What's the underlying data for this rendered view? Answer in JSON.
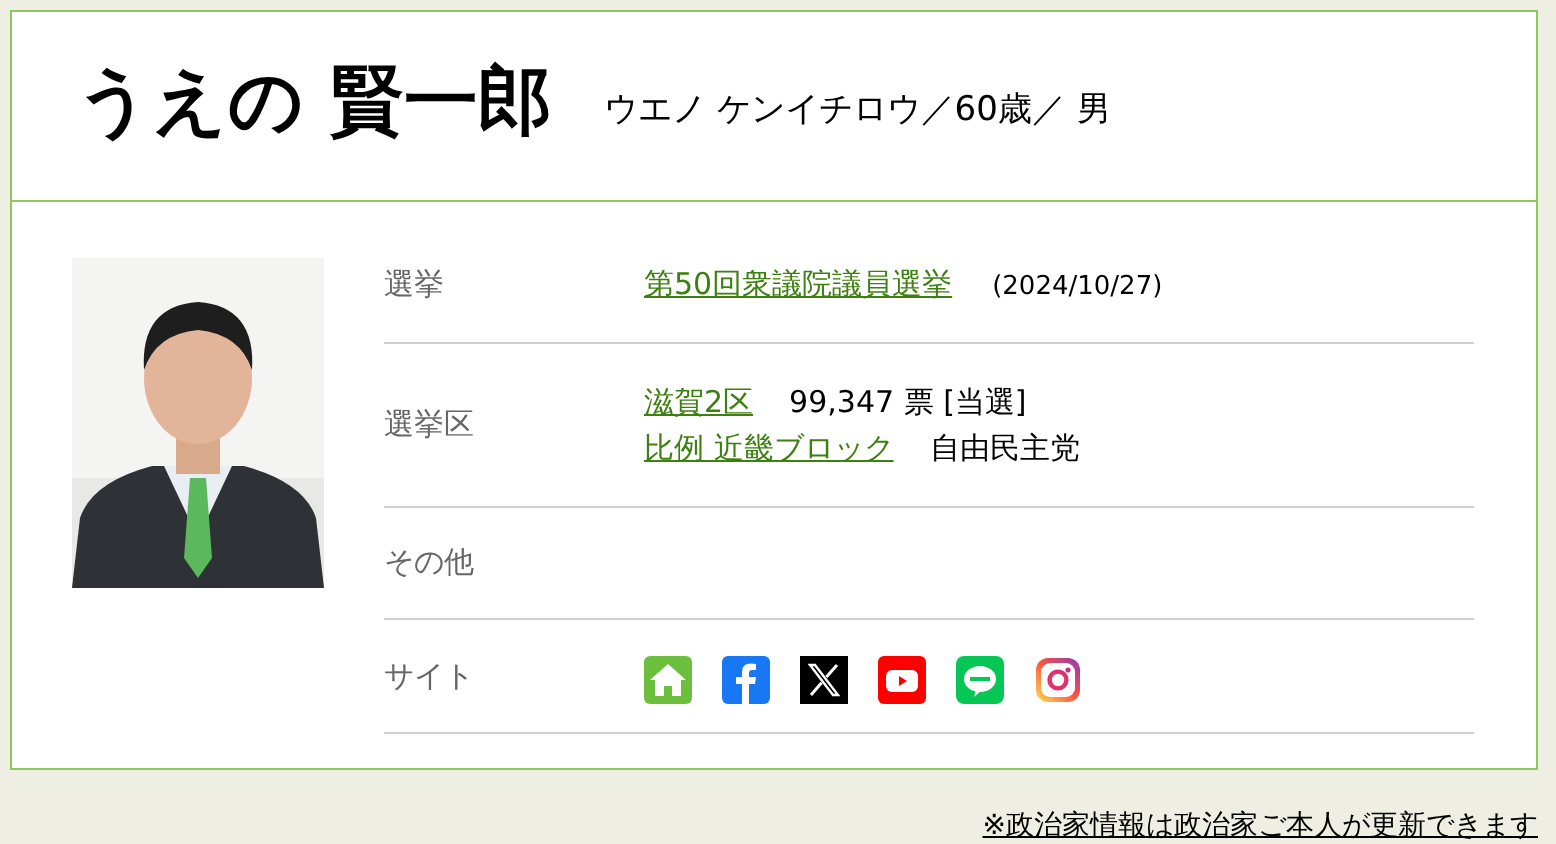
{
  "profile": {
    "name": "うえの 賢一郎",
    "reading": "ウエノ ケンイチロウ／60歳／ 男"
  },
  "rows": [
    {
      "kind": "text",
      "label": "選挙",
      "lines": [
        {
          "link": "第50回衆議院議員選挙",
          "note": "(2024/10/27)"
        }
      ]
    },
    {
      "kind": "text",
      "label": "選挙区",
      "lines": [
        {
          "link": "滋賀2区",
          "text": "99,347 票 [当選]"
        },
        {
          "link": "比例 近畿ブロック",
          "text": "自由民主党"
        }
      ]
    },
    {
      "kind": "text",
      "label": "その他",
      "lines": []
    },
    {
      "kind": "sites",
      "label": "サイト",
      "sites": [
        {
          "kind": "home"
        },
        {
          "kind": "facebook"
        },
        {
          "kind": "x"
        },
        {
          "kind": "youtube"
        },
        {
          "kind": "line"
        },
        {
          "kind": "instagram"
        }
      ]
    }
  ],
  "footer_link": "※政治家情報は政治家ご本人が更新できます"
}
